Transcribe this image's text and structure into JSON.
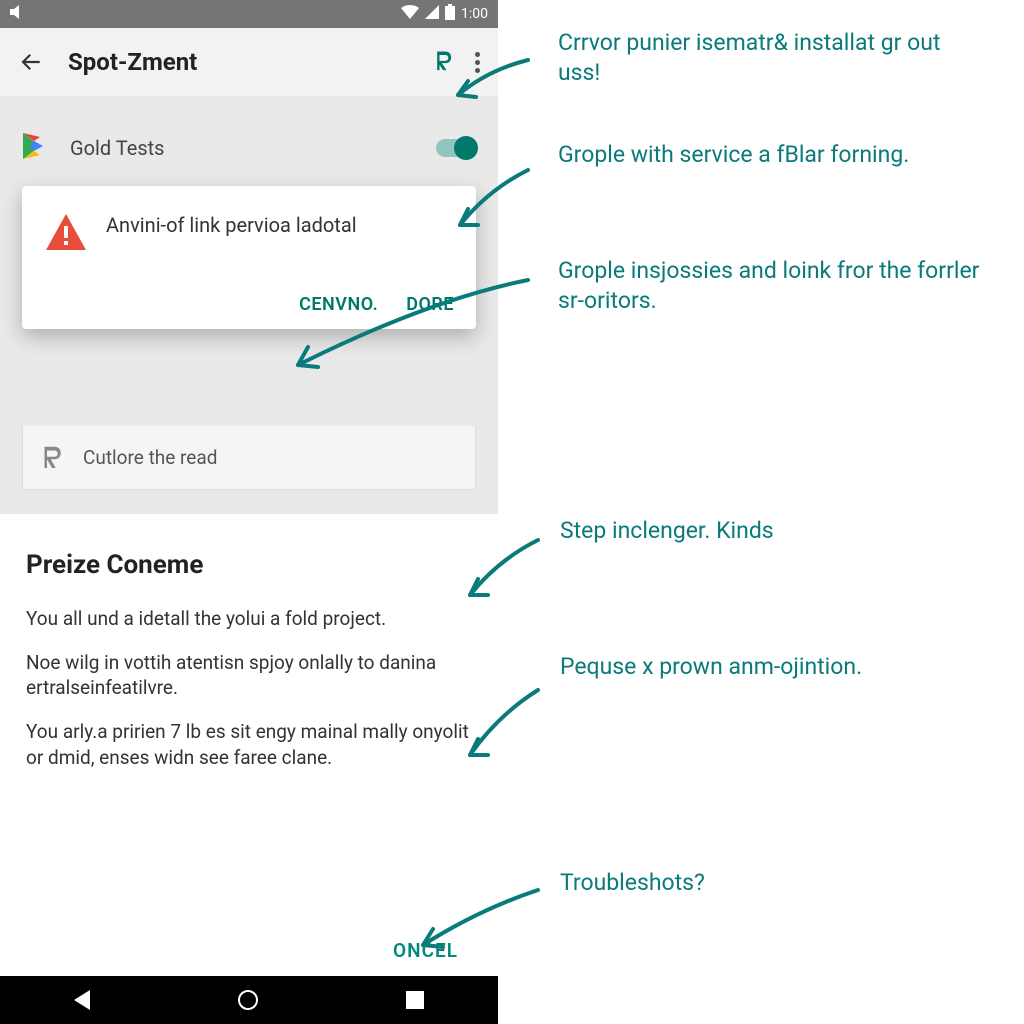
{
  "statusbar": {
    "time": "1:00"
  },
  "appbar": {
    "title": "Spot-Zment"
  },
  "rows": {
    "gold_tests": "Gold Tests"
  },
  "dialog": {
    "message": "Anvini-of link pervioa ladotal",
    "cancel": "CENVNO.",
    "confirm": "DORE"
  },
  "list_item": {
    "label": "Cutlore the read"
  },
  "sheet": {
    "title": "Preize Coneme",
    "p1": "You all und a idetall the yolui a fold project.",
    "p2": "Noe wilg in vottih atentisn spjoy onlally to danina ertralseinfeatilvre.",
    "p3": "You arly.a pririen 7 lb es sit engy mainal mally onyolit or dmid, enses widn see faree clane.",
    "action": "ONCEL"
  },
  "annotations": {
    "a1": "Crrvor punier isematr& installat gr out uss!",
    "a2": "Grople with service a fBlar forning.",
    "a3": "Grople insjossies and loink fror the forrler sr-oritors.",
    "a4": "Step inclenger. Kinds",
    "a5": "Pequse x prown anm-ojintion.",
    "a6": "Troubleshots?"
  }
}
